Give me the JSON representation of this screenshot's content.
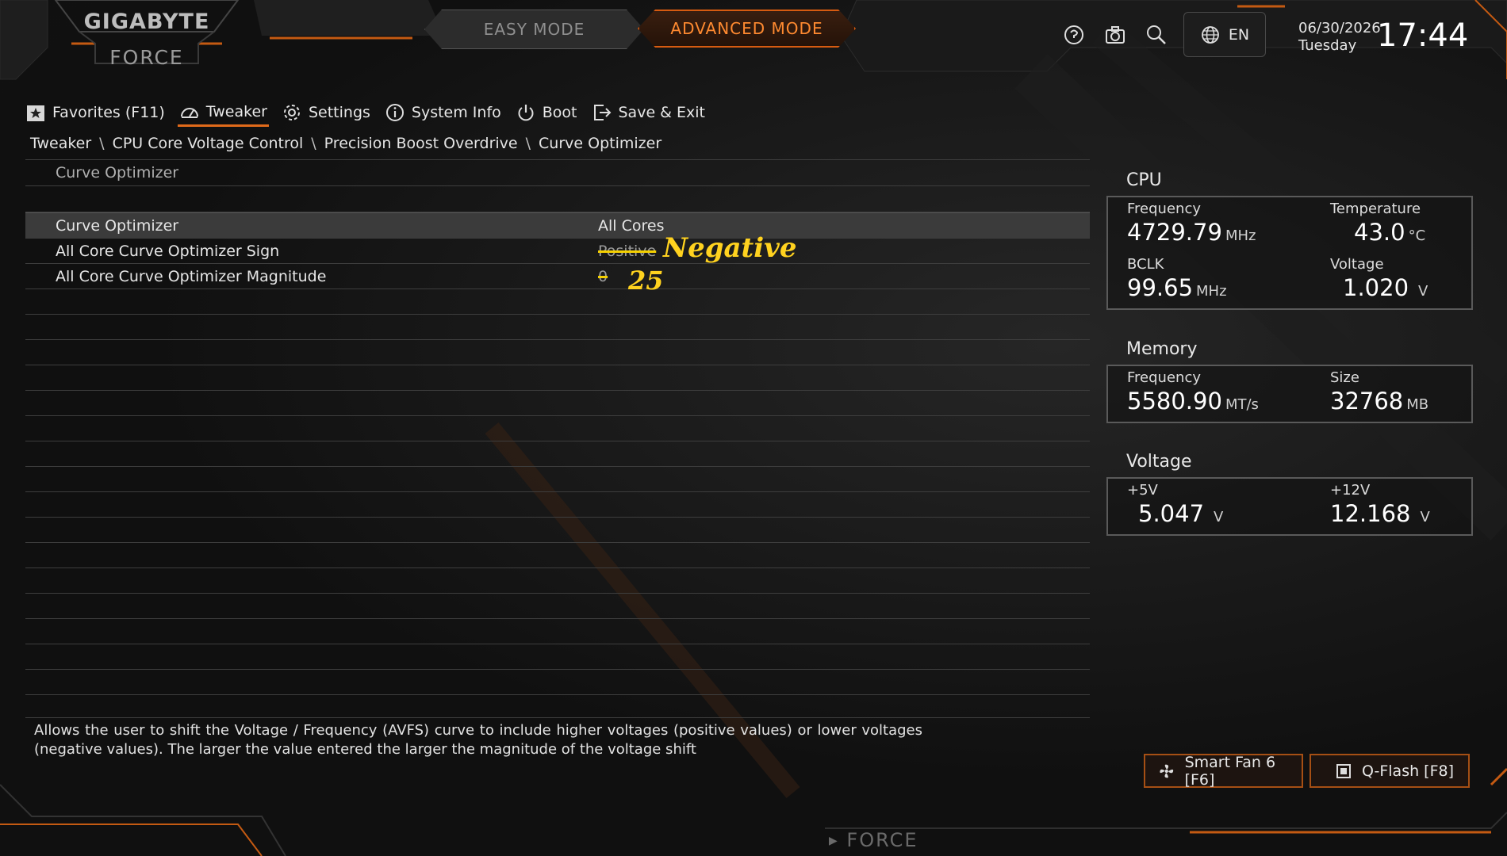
{
  "header": {
    "brand": "GIGABYTE",
    "sub_brand": "FORCE",
    "mode_easy": "EASY MODE",
    "mode_advanced": "ADVANCED MODE",
    "language": "EN",
    "date": "06/30/2026",
    "weekday": "Tuesday",
    "time": "17:44",
    "icons": [
      "help-icon",
      "camera-icon",
      "search-icon",
      "globe-icon"
    ]
  },
  "nav": [
    {
      "label": "Favorites (F11)",
      "icon": "star-icon"
    },
    {
      "label": "Tweaker",
      "icon": "gauge-icon",
      "active": true
    },
    {
      "label": "Settings",
      "icon": "gear-icon"
    },
    {
      "label": "System Info",
      "icon": "info-icon"
    },
    {
      "label": "Boot",
      "icon": "power-icon"
    },
    {
      "label": "Save & Exit",
      "icon": "exit-icon"
    }
  ],
  "breadcrumb": [
    "Tweaker",
    "CPU Core Voltage Control",
    "Precision Boost Overdrive",
    "Curve Optimizer"
  ],
  "section_header": "Curve Optimizer",
  "settings": [
    {
      "label": "Curve Optimizer",
      "value": "All Cores"
    },
    {
      "label": "All Core Curve Optimizer Sign",
      "value": "Positive",
      "annotation": "Negative"
    },
    {
      "label": "All Core Curve Optimizer Magnitude",
      "value": "0",
      "annotation": "25"
    }
  ],
  "description": "Allows the user to shift the Voltage / Frequency (AVFS) curve to include higher voltages (positive values) or lower voltages (negative values). The larger the value entered the larger the magnitude of the voltage shift",
  "monitor": {
    "cpu": {
      "title": "CPU",
      "frequency_label": "Frequency",
      "frequency_value": "4729.79",
      "frequency_unit": "MHz",
      "temperature_label": "Temperature",
      "temperature_value": "43.0",
      "temperature_unit": "°C",
      "bclk_label": "BCLK",
      "bclk_value": "99.65",
      "bclk_unit": "MHz",
      "voltage_label": "Voltage",
      "voltage_value": "1.020",
      "voltage_unit": "V"
    },
    "memory": {
      "title": "Memory",
      "frequency_label": "Frequency",
      "frequency_value": "5580.90",
      "frequency_unit": "MT/s",
      "size_label": "Size",
      "size_value": "32768",
      "size_unit": "MB"
    },
    "voltage": {
      "title": "Voltage",
      "v5_label": "+5V",
      "v5_value": "5.047",
      "v5_unit": "V",
      "v12_label": "+12V",
      "v12_value": "12.168",
      "v12_unit": "V"
    }
  },
  "buttons": {
    "smart_fan": "Smart Fan 6 [F6]",
    "qflash": "Q-Flash [F8]"
  },
  "footer_brand": "FORCE",
  "colors": {
    "accent": "#e06a1a",
    "annotation": "#ffd21f"
  }
}
